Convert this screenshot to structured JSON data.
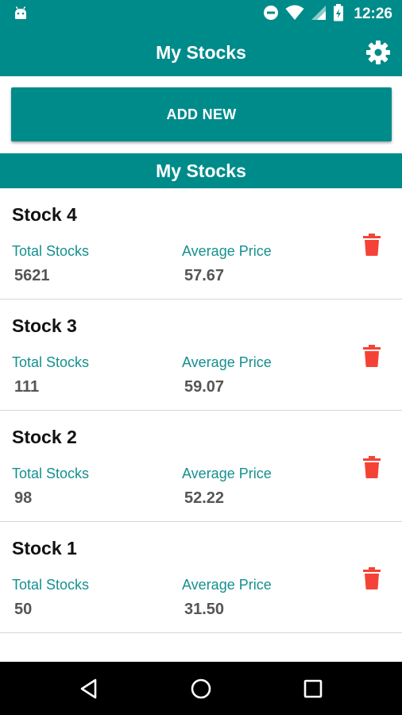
{
  "status_bar": {
    "time": "12:26",
    "icons": [
      "android-icon",
      "do-not-disturb-icon",
      "wifi-icon",
      "signal-icon",
      "battery-icon"
    ]
  },
  "app_bar": {
    "title": "My Stocks",
    "settings_icon": "gear-icon"
  },
  "add_button": {
    "label": "ADD NEW"
  },
  "section": {
    "title": "My Stocks"
  },
  "labels": {
    "total_stocks": "Total Stocks",
    "average_price": "Average Price"
  },
  "stocks": [
    {
      "name": "Stock 4",
      "total": "5621",
      "avg_price": "57.67"
    },
    {
      "name": "Stock 3",
      "total": "111",
      "avg_price": "59.07"
    },
    {
      "name": "Stock 2",
      "total": "98",
      "avg_price": "52.22"
    },
    {
      "name": "Stock 1",
      "total": "50",
      "avg_price": "31.50"
    }
  ],
  "nav_bar": {
    "icons": [
      "back-icon",
      "home-icon",
      "recents-icon"
    ]
  },
  "colors": {
    "primary": "#008b8b",
    "label_teal": "#15908f",
    "delete_red": "#f44336",
    "value_gray": "#555555"
  }
}
